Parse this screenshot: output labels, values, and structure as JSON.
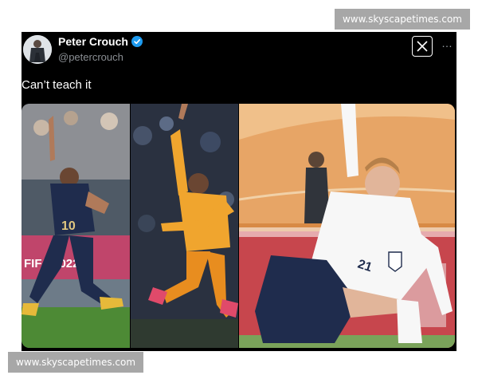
{
  "watermarks": {
    "top": "www.skyscapetimes.com",
    "bottom": "www.skyscapetimes.com"
  },
  "tweet": {
    "author_name": "Peter Crouch",
    "author_handle": "@petercrouch",
    "verified": true,
    "text": "Can’t teach it",
    "more_icon": "…",
    "logo": "x-logo-icon"
  },
  "media": {
    "panels": [
      {
        "name": "photo-player-blue-kit",
        "jersey_number": "10",
        "board_text": "FIFA 2022"
      },
      {
        "name": "photo-player-orange-kit"
      },
      {
        "name": "photo-player-white-kit",
        "jersey_number": "21"
      }
    ]
  },
  "colors": {
    "background": "#000000",
    "handle": "#8b8f94",
    "verified_badge": "#1d9bf0"
  }
}
